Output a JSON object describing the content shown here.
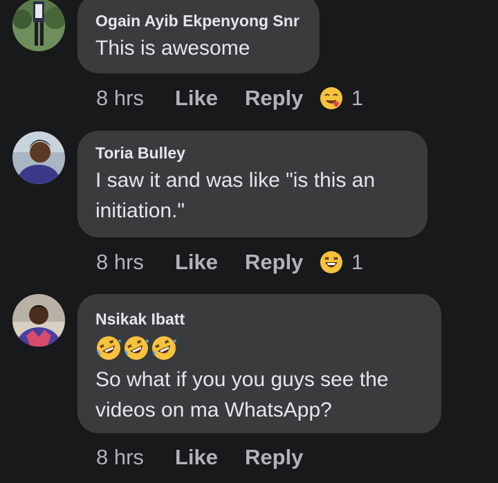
{
  "comments": [
    {
      "author": "Ogain Ayib Ekpenyong Snr",
      "text": "This is awesome",
      "time": "8 hrs",
      "like_label": "Like",
      "reply_label": "Reply",
      "reaction": "smile-heart-icon",
      "reaction_count": "1"
    },
    {
      "author": "Toria Bulley",
      "text": "I saw it and was like \"is this an initiation.\"",
      "time": "8 hrs",
      "like_label": "Like",
      "reply_label": "Reply",
      "reaction": "laughing-icon",
      "reaction_count": "1"
    },
    {
      "author": "Nsikak Ibatt",
      "emojis": [
        "rofl-icon",
        "rofl-icon",
        "rofl-icon"
      ],
      "text": "So what if you you guys see the videos on ma WhatsApp?",
      "time": "8 hrs",
      "like_label": "Like",
      "reply_label": "Reply"
    }
  ],
  "colors": {
    "background": "#18191a",
    "bubble": "#3a3b3c",
    "text": "#e4e6eb",
    "secondary_text": "#b0b3b8",
    "emoji_yellow": "#f7c23c"
  }
}
